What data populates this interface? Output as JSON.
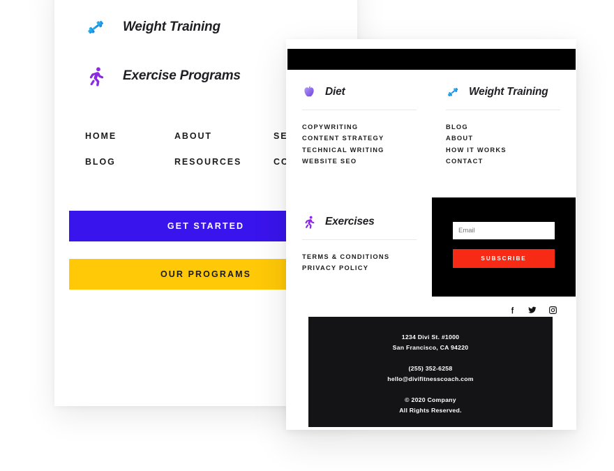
{
  "page": {
    "background": "#ffffff",
    "description": "Two overlapping white footer-design cards on a white background"
  },
  "back_card": {
    "features": [
      {
        "icon": "dumbbell-icon",
        "label": "Weight Training",
        "color": "#29a8e0"
      },
      {
        "icon": "running-person-icon",
        "label": "Exercise Programs",
        "color": "#8a2be2"
      }
    ],
    "nav": [
      "HOME",
      "ABOUT",
      "SERVICES",
      "BLOG",
      "RESOURCES",
      "CONTACT"
    ],
    "buttons": [
      {
        "label": "GET STARTED",
        "background": "#3a14ec",
        "text_color": "#ffffff"
      },
      {
        "label": "OUR PROGRAMS",
        "background": "#ffc907",
        "text_color": "#1c1c1f"
      }
    ]
  },
  "decor": {
    "arrow_color": "#fbc41c",
    "arrow_name": "yellow-arrow-decoration"
  },
  "front_card": {
    "topbar_color": "#000000",
    "columns": [
      {
        "icon": "apple-icon",
        "title": "Diet",
        "links": [
          "COPYWRITING",
          "CONTENT STRATEGY",
          "TECHNICAL WRITING",
          "WEBSITE SEO"
        ]
      },
      {
        "icon": "dumbbell-icon",
        "title": "Weight Training",
        "links": [
          "BLOG",
          "ABOUT",
          "HOW IT WORKS",
          "CONTACT"
        ]
      },
      {
        "icon": "running-person-icon",
        "title": "Exercises",
        "links": [
          "TERMS & CONDITIONS",
          "PRIVACY POLICY"
        ]
      }
    ],
    "subscribe": {
      "panel_background": "#000000",
      "email_placeholder": "Email",
      "email_value": "",
      "button_label": "SUBSCRIBE",
      "button_color": "#f72a16"
    },
    "social": [
      {
        "name": "facebook-icon",
        "glyph": "f"
      },
      {
        "name": "twitter-icon",
        "glyph": "twitter"
      },
      {
        "name": "instagram-icon",
        "glyph": "instagram"
      }
    ],
    "address": {
      "background": "#141416",
      "street": "1234 Divi St. #1000",
      "city": "San Francisco, CA 94220",
      "phone": "(255) 352-6258",
      "email": "hello@divifitnesscoach.com",
      "copyright": "© 2020 Company",
      "rights": "All Rights Reserved."
    }
  }
}
